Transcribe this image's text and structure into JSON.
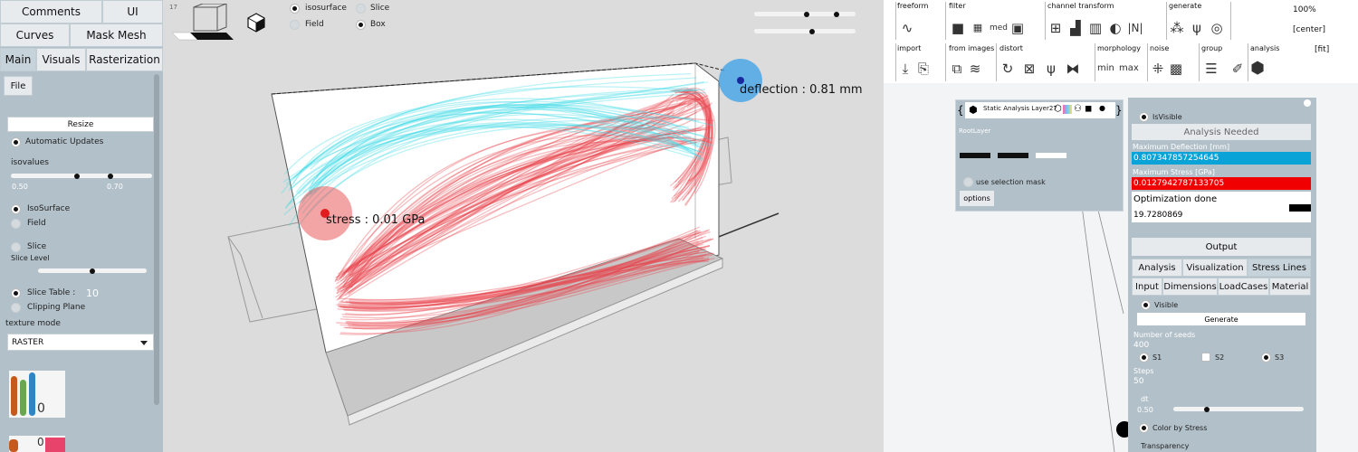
{
  "left_panel": {
    "top_tabs": [
      "Comments",
      "UI",
      "Curves",
      "Mask Mesh"
    ],
    "tabs": [
      "Main",
      "Visuals",
      "Rasterization"
    ],
    "active_tab": "Main",
    "file_tab": "File",
    "resize_button": "Resize",
    "automatic_updates": "Automatic Updates",
    "isovalues_label": "isovalues",
    "iso_min": "0.50",
    "iso_max": "0.70",
    "isosurface_label": "IsoSurface",
    "field_label": "Field",
    "slice_label": "Slice",
    "slice_level_label": "Slice Level",
    "slice_table_label": "Slice Table :",
    "slice_table_value": "10",
    "clipping_plane_label": "Clipping Plane",
    "texture_mode_label": "texture mode",
    "texture_mode_value": "RASTER",
    "histogram_zero": "0",
    "legend_zero": "0",
    "colors": {
      "panel_bg": "#b2c0c9",
      "bar_orange": "#c55a1e",
      "bar_green": "#6aa84f",
      "bar_blue": "#2f86c5",
      "bar_pink": "#e8436b"
    }
  },
  "viewport": {
    "frame_number": "17",
    "isosurface_label": "isosurface",
    "slice_label": "Slice",
    "field_label": "Field",
    "box_label": "Box",
    "stress_annotation": "stress : 0.01 GPa",
    "deflection_annotation": "deflection : 0.81 mm",
    "colors": {
      "stress_lines": "#e8434b",
      "deflection_lines": "#39d9e6",
      "stress_marker": "#e21c1c",
      "deflection_marker": "#1a2a9c"
    }
  },
  "toolbar": {
    "groups": [
      {
        "label": "freeform",
        "icons": [
          "curve-icon"
        ]
      },
      {
        "label": "filter",
        "icons": [
          "square-icon",
          "grid-icon",
          "med-icon",
          "frame-icon"
        ]
      },
      {
        "label": "channel transform",
        "icons": [
          "hash-icon",
          "histogram-icon",
          "bars-icon",
          "half-icon",
          "abs-icon"
        ]
      },
      {
        "label": "generate",
        "icons": [
          "sparkle-icon",
          "psi-icon",
          "swirl-icon"
        ]
      },
      {
        "label": "import",
        "icons": [
          "import-mesh-icon",
          "import-doc-icon"
        ]
      },
      {
        "label": "from images",
        "icons": [
          "stack-icon",
          "layers-icon"
        ]
      },
      {
        "label": "distort",
        "icons": [
          "swirl2-icon",
          "pinch-icon",
          "psi2-icon",
          "mirror-icon"
        ]
      },
      {
        "label": "morphology",
        "icons": [
          "min-icon",
          "max-icon"
        ]
      },
      {
        "label": "noise",
        "icons": [
          "noise-icon",
          "texture-icon"
        ]
      },
      {
        "label": "group",
        "icons": [
          "group-icon"
        ]
      },
      {
        "label": "analysis",
        "icons": [
          "brush-icon",
          "hexagon-icon"
        ]
      }
    ],
    "med_text": "med",
    "abs_text": "|N|",
    "min_text": "min",
    "max_text": "max",
    "zoom": "100%",
    "center": "[center]",
    "fit": "[fit]"
  },
  "layer_panel": {
    "layer_name": "Static Analysis Layer27",
    "brace_open": "{",
    "brace_close": "}",
    "root_layer": "RootLayer",
    "use_selection_mask": "use selection mask",
    "options_button": "options"
  },
  "analysis_panel": {
    "is_visible": "IsVisible",
    "analysis_needed": "Analysis Needed",
    "max_deflection_label": "Maximum Deflection [mm]",
    "max_deflection_value": "0.807347857254645",
    "max_stress_label": "Maximum Stress [GPa]",
    "max_stress_value": "0.0127942787133705",
    "optimization_done": "Optimization done",
    "optimization_value": "19.7280869",
    "output_button": "Output",
    "tabs_row1": [
      "Analysis",
      "Visualization",
      "Stress Lines"
    ],
    "active_tab_row1": "Stress Lines",
    "tabs_row2": [
      "Input",
      "Dimensions",
      "LoadCases",
      "Material"
    ],
    "visible_label": "Visible",
    "generate_button": "Generate",
    "number_of_seeds_label": "Number of seeds",
    "number_of_seeds_value": "400",
    "s1_label": "S1",
    "s2_label": "S2",
    "s3_label": "S3",
    "steps_label": "Steps",
    "steps_value": "50",
    "dt_label": "dt",
    "dt_value": "0.50",
    "color_by_stress": "Color by Stress",
    "transparency_label": "Transparency",
    "colors": {
      "deflection_bg": "#0aa3d8",
      "stress_bg": "#f00000"
    }
  }
}
